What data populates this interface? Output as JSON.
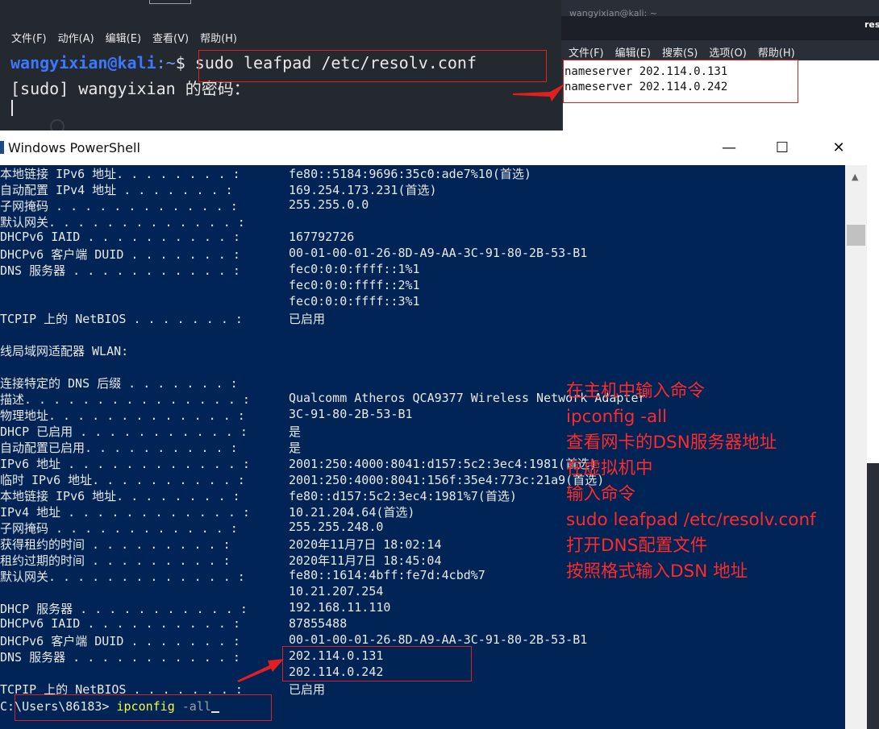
{
  "kali": {
    "menu": [
      "文件(F)",
      "动作(A)",
      "编辑(E)",
      "查看(V)",
      "帮助(H)"
    ],
    "prompt_user": "wangyixian@kali",
    "prompt_path": ":~",
    "prompt_symbol": "$",
    "command": " sudo leafpad /etc/resolv.conf",
    "sudo_prompt": "[sudo] wangyixian 的密码："
  },
  "leafpad": {
    "title": "wangyixian@kali: ~",
    "title_right": "reso",
    "menu": [
      "文件(F)",
      "编辑(E)",
      "搜索(S)",
      "选项(O)",
      "帮助(H)"
    ],
    "lines": [
      "nameserver 202.114.0.131",
      "nameserver 202.114.0.242"
    ]
  },
  "powershell": {
    "title": "Windows PowerShell",
    "controls": {
      "minimize": "—",
      "maximize": "☐",
      "close": "✕"
    },
    "rows": [
      {
        "label": "本地链接 IPv6 地址. . . . . . . . :",
        "value": "fe80::5184:9696:35c0:ade7%10(首选)"
      },
      {
        "label": "自动配置 IPv4 地址 . . . . . . . :",
        "value": "169.254.173.231(首选)"
      },
      {
        "label": "子网掩码 . . . . . . . . . . . . :",
        "value": "255.255.0.0"
      },
      {
        "label": "默认网关. . . . . . . . . . . . . :",
        "value": ""
      },
      {
        "label": "DHCPv6 IAID . . . . . . . . . . :",
        "value": "167792726"
      },
      {
        "label": "DHCPv6 客户端 DUID . . . . . . . :",
        "value": "00-01-00-01-26-8D-A9-AA-3C-91-80-2B-53-B1"
      },
      {
        "label": "DNS 服务器 . . . . . . . . . . . :",
        "value": "fec0:0:0:ffff::1%1"
      },
      {
        "label": "",
        "value": "fec0:0:0:ffff::2%1"
      },
      {
        "label": "",
        "value": "fec0:0:0:ffff::3%1"
      },
      {
        "label": "TCPIP 上的 NetBIOS . . . . . . . :",
        "value": "已启用"
      },
      {
        "label": "",
        "value": ""
      },
      {
        "label": "线局域网适配器 WLAN:",
        "value": ""
      },
      {
        "label": "",
        "value": ""
      },
      {
        "label": "连接特定的 DNS 后缀 . . . . . . . :",
        "value": ""
      },
      {
        "label": "描述. . . . . . . . . . . . . . . :",
        "value": "Qualcomm Atheros QCA9377 Wireless Network Adapter"
      },
      {
        "label": "物理地址. . . . . . . . . . . . . :",
        "value": "3C-91-80-2B-53-B1"
      },
      {
        "label": "DHCP 已启用 . . . . . . . . . . . :",
        "value": "是"
      },
      {
        "label": "自动配置已启用. . . . . . . . . . :",
        "value": "是"
      },
      {
        "label": "IPv6 地址 . . . . . . . . . . . . :",
        "value": "2001:250:4000:8041:d157:5c2:3ec4:1981(首选)"
      },
      {
        "label": "临时 IPv6 地址. . . . . . . . . . :",
        "value": "2001:250:4000:8041:156f:35e4:773c:21a9(首选)"
      },
      {
        "label": "本地链接 IPv6 地址. . . . . . . . :",
        "value": "fe80::d157:5c2:3ec4:1981%7(首选)"
      },
      {
        "label": "IPv4 地址 . . . . . . . . . . . . :",
        "value": "10.21.204.64(首选)"
      },
      {
        "label": "子网掩码 . . . . . . . . . . . . :",
        "value": "255.255.248.0"
      },
      {
        "label": "获得租约的时间 . . . . . . . . . :",
        "value": "2020年11月7日 18:02:14"
      },
      {
        "label": "租约过期的时间 . . . . . . . . . :",
        "value": "2020年11月7日 18:45:04"
      },
      {
        "label": "默认网关. . . . . . . . . . . . . :",
        "value": "fe80::1614:4bff:fe7d:4cbd%7"
      },
      {
        "label": "",
        "value": "10.21.207.254"
      },
      {
        "label": "DHCP 服务器 . . . . . . . . . . . :",
        "value": "192.168.11.110"
      },
      {
        "label": "DHCPv6 IAID . . . . . . . . . . :",
        "value": "87855488"
      },
      {
        "label": "DHCPv6 客户端 DUID . . . . . . . :",
        "value": "00-01-00-01-26-8D-A9-AA-3C-91-80-2B-53-B1"
      },
      {
        "label": "DNS 服务器 . . . . . . . . . . . :",
        "value": "202.114.0.131"
      },
      {
        "label": "",
        "value": "202.114.0.242"
      },
      {
        "label": "TCPIP 上的 NetBIOS . . . . . . . :",
        "value": "已启用"
      }
    ],
    "prompt_path": "C:\\Users\\86183> ",
    "prompt_cmd": "ipconfig",
    "prompt_arg": " -all"
  },
  "annotation": {
    "color": "#ff2a2a",
    "lines": [
      "在主机中输入命令",
      "ipconfig -all",
      "查看网卡的DSN服务器地址",
      "在虚拟机中",
      "输入命令",
      "sudo leafpad /etc/resolv.conf",
      "打开DNS配置文件",
      "按照格式输入DSN 地址"
    ]
  }
}
